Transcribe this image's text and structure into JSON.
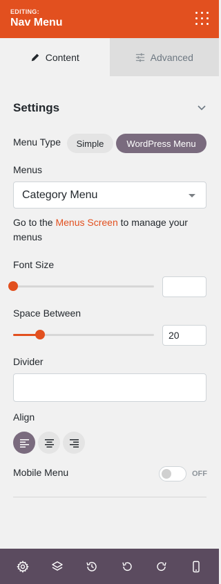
{
  "header": {
    "editing_label": "EDITING:",
    "title": "Nav Menu"
  },
  "tabs": [
    {
      "label": "Content",
      "icon": "pencil-icon",
      "active": true
    },
    {
      "label": "Advanced",
      "icon": "sliders-icon",
      "active": false
    }
  ],
  "section": {
    "title": "Settings"
  },
  "menu_type": {
    "label": "Menu Type",
    "options": [
      "Simple",
      "WordPress Menu"
    ],
    "selected": "WordPress Menu"
  },
  "menus": {
    "label": "Menus",
    "value": "Category Menu"
  },
  "hint": {
    "before": "Go to the ",
    "link": "Menus Screen",
    "after": " to manage your menus"
  },
  "font_size": {
    "label": "Font Size",
    "value": "",
    "level": 0
  },
  "space_between": {
    "label": "Space Between",
    "value": "20",
    "level": 0.19
  },
  "divider": {
    "label": "Divider",
    "value": ""
  },
  "align": {
    "label": "Align",
    "options": [
      "left",
      "center",
      "right"
    ],
    "selected": "left"
  },
  "mobile_menu": {
    "label": "Mobile Menu",
    "state": "OFF"
  },
  "footer": {
    "icons": [
      "gear-icon",
      "layers-icon",
      "history-icon",
      "undo-icon",
      "redo-icon",
      "mobile-icon"
    ]
  },
  "colors": {
    "accent": "#e2501f",
    "purple": "#7a6b7e",
    "footer": "#5b4b5f"
  }
}
